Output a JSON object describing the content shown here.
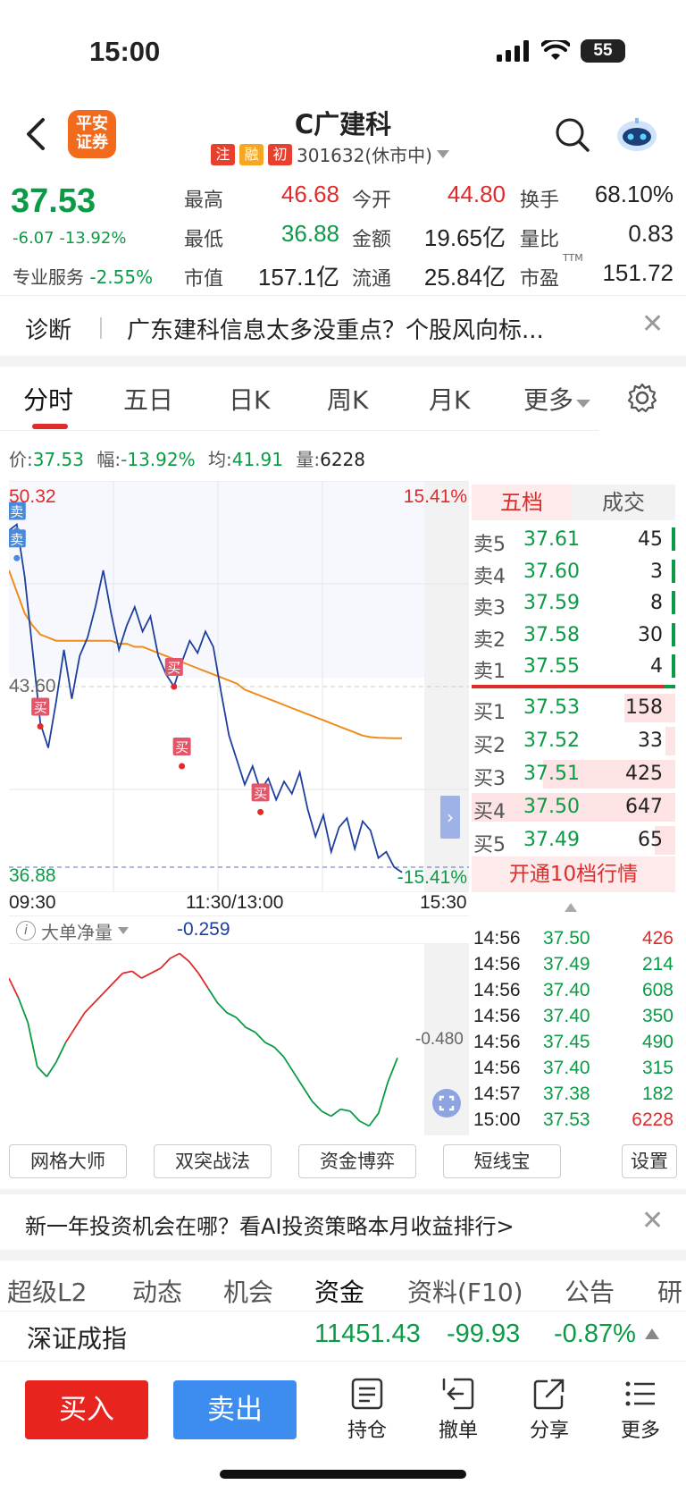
{
  "status": {
    "time": "15:00",
    "battery": "55"
  },
  "header": {
    "logo_line1": "平安",
    "logo_line2": "证券",
    "name": "C广建科",
    "tags": [
      {
        "text": "注",
        "color": "#e8402e"
      },
      {
        "text": "融",
        "color": "#f5a623"
      },
      {
        "text": "初",
        "color": "#e8402e"
      }
    ],
    "code_status": "301632(休市中)",
    "icons": {
      "back": "back-arrow-icon",
      "search": "search-icon",
      "assistant": "robot-assistant-icon",
      "dropdown": "caret-down-icon"
    }
  },
  "quote": {
    "price": "37.53",
    "change": "-6.07",
    "change_pct": "-13.92%",
    "industry_label": "专业服务",
    "industry_pct": "-2.55%",
    "cells": [
      {
        "label": "最高",
        "value": "46.68",
        "color": "red"
      },
      {
        "label": "今开",
        "value": "44.80",
        "color": "red"
      },
      {
        "label": "换手",
        "value": "68.10%",
        "color": "black"
      },
      {
        "label": "最低",
        "value": "36.88",
        "color": "green"
      },
      {
        "label": "金额",
        "value": "19.65亿",
        "color": "black"
      },
      {
        "label": "量比",
        "value": "0.83",
        "color": "black"
      },
      {
        "label": "市值",
        "value": "157.1亿",
        "color": "black"
      },
      {
        "label": "流通",
        "value": "25.84亿",
        "color": "black"
      },
      {
        "label": "市盈",
        "value": "151.72",
        "color": "black"
      }
    ],
    "pe_superscript": "TTM"
  },
  "diagnosis": {
    "label": "诊断",
    "text": "广东建科信息太多没重点？个股风向标..."
  },
  "chart_tabs": [
    "分时",
    "五日",
    "日K",
    "周K",
    "月K",
    "更多"
  ],
  "chart_tabs_active": 0,
  "info_line": {
    "price_label": "价:",
    "price": "37.53",
    "range_label": "幅:",
    "range": "-13.92%",
    "avg_label": "均:",
    "avg": "41.91",
    "vol_label": "量:",
    "vol": "6228"
  },
  "chart_data": [
    {
      "type": "line",
      "title": "",
      "y_high": "50.32",
      "y_mid": "43.60",
      "y_low": "36.88",
      "pct_high": "15.41%",
      "pct_low": "-15.41%",
      "x_labels": [
        "09:30",
        "11:30/13:00",
        "15:30"
      ],
      "ylim": [
        36.88,
        50.32
      ],
      "series": [
        {
          "key": "price",
          "color": "#1e3f9e",
          "values": [
            48.7,
            48.9,
            47.2,
            44.8,
            42.4,
            41.6,
            43.1,
            44.8,
            43.2,
            44.6,
            45.2,
            46.2,
            47.4,
            46.0,
            44.8,
            45.6,
            46.2,
            45.4,
            45.9,
            44.6,
            44.0,
            43.6,
            44.4,
            45.1,
            44.7,
            45.4,
            44.9,
            43.4,
            42.0,
            41.2,
            40.4,
            41.0,
            40.2,
            40.6,
            39.9,
            40.5,
            40.1,
            40.8,
            39.6,
            38.7,
            39.4,
            38.2,
            39.0,
            39.3,
            38.3,
            39.2,
            38.9,
            38.0,
            38.2,
            37.7,
            37.53
          ]
        },
        {
          "key": "avg",
          "color": "#f08c1e",
          "values": [
            47.4,
            46.7,
            46.0,
            45.6,
            45.3,
            45.2,
            45.1,
            45.1,
            45.1,
            45.1,
            45.1,
            45.1,
            45.1,
            45.1,
            45.0,
            45.0,
            44.9,
            44.9,
            44.8,
            44.7,
            44.6,
            44.5,
            44.4,
            44.3,
            44.2,
            44.1,
            44.0,
            43.9,
            43.8,
            43.7,
            43.5,
            43.4,
            43.3,
            43.2,
            43.1,
            43.0,
            42.9,
            42.8,
            42.7,
            42.6,
            42.5,
            42.4,
            42.3,
            42.2,
            42.1,
            42.0,
            41.95,
            41.93,
            41.92,
            41.91,
            41.91
          ]
        }
      ],
      "markers": [
        {
          "label": "卖",
          "kind": "sell",
          "x_index": 1,
          "value": 48.7
        },
        {
          "label": "卖",
          "kind": "sell",
          "x_index": 1,
          "value": 47.8
        },
        {
          "label": "买",
          "kind": "buy",
          "x_index": 4,
          "value": 42.3
        },
        {
          "label": "买",
          "kind": "buy",
          "x_index": 21,
          "value": 43.6
        },
        {
          "label": "买",
          "kind": "buy",
          "x_index": 22,
          "value": 41.0
        },
        {
          "label": "买",
          "kind": "buy",
          "x_index": 32,
          "value": 39.5
        }
      ]
    },
    {
      "type": "line",
      "title": "",
      "label": "大单净量",
      "value_now": "-0.259",
      "ref_value": "-0.480",
      "series": [
        {
          "key": "net",
          "values": [
            0.55,
            0.35,
            0.1,
            -0.35,
            -0.45,
            -0.3,
            -0.1,
            0.05,
            0.2,
            0.3,
            0.4,
            0.5,
            0.6,
            0.62,
            0.55,
            0.6,
            0.65,
            0.75,
            0.8,
            0.72,
            0.6,
            0.45,
            0.3,
            0.2,
            0.15,
            0.05,
            0.0,
            -0.1,
            -0.15,
            -0.25,
            -0.4,
            -0.55,
            -0.7,
            -0.8,
            -0.85,
            -0.78,
            -0.8,
            -0.9,
            -0.95,
            -0.82,
            -0.5,
            -0.259
          ]
        }
      ]
    }
  ],
  "orderbook": {
    "tabs": [
      "五档",
      "成交"
    ],
    "sells": [
      {
        "label": "卖5",
        "price": "37.61",
        "vol": "45"
      },
      {
        "label": "卖4",
        "price": "37.60",
        "vol": "3"
      },
      {
        "label": "卖3",
        "price": "37.59",
        "vol": "8"
      },
      {
        "label": "卖2",
        "price": "37.58",
        "vol": "30"
      },
      {
        "label": "卖1",
        "price": "37.55",
        "vol": "4"
      }
    ],
    "buys": [
      {
        "label": "买1",
        "price": "37.53",
        "vol": "158",
        "depth": 0.25
      },
      {
        "label": "买2",
        "price": "37.52",
        "vol": "33",
        "depth": 0.05
      },
      {
        "label": "买3",
        "price": "37.51",
        "vol": "425",
        "depth": 0.65
      },
      {
        "label": "买4",
        "price": "37.50",
        "vol": "647",
        "depth": 1.0
      },
      {
        "label": "买5",
        "price": "37.49",
        "vol": "65",
        "depth": 0.1
      }
    ],
    "open_l2": "开通10档行情"
  },
  "trades": [
    {
      "time": "14:56",
      "price": "37.50",
      "vol": "426",
      "dir": "red"
    },
    {
      "time": "14:56",
      "price": "37.49",
      "vol": "214",
      "dir": "green"
    },
    {
      "time": "14:56",
      "price": "37.40",
      "vol": "608",
      "dir": "green"
    },
    {
      "time": "14:56",
      "price": "37.40",
      "vol": "350",
      "dir": "green"
    },
    {
      "time": "14:56",
      "price": "37.45",
      "vol": "490",
      "dir": "green"
    },
    {
      "time": "14:56",
      "price": "37.40",
      "vol": "315",
      "dir": "green"
    },
    {
      "time": "14:57",
      "price": "37.38",
      "vol": "182",
      "dir": "green"
    },
    {
      "time": "15:00",
      "price": "37.53",
      "vol": "6228",
      "dir": "red"
    }
  ],
  "tools": [
    "网格大师",
    "双突战法",
    "资金博弈",
    "短线宝",
    "设置"
  ],
  "ad": {
    "text": "新一年投资机会在哪？看AI投资策略本月收益排行>"
  },
  "bottom_tabs": [
    "超级L2",
    "动态",
    "机会",
    "资金",
    "资料(F10)",
    "公告",
    "研"
  ],
  "bottom_tabs_active": 3,
  "index": {
    "name": "深证成指",
    "value": "11451.43",
    "change": "-99.93",
    "pct": "-0.87%"
  },
  "actions": {
    "buy": "买入",
    "sell": "卖出",
    "items": [
      {
        "label": "持仓",
        "icon": "holdings-icon"
      },
      {
        "label": "撤单",
        "icon": "cancel-order-icon"
      },
      {
        "label": "分享",
        "icon": "share-icon"
      },
      {
        "label": "更多",
        "icon": "more-menu-icon"
      }
    ]
  }
}
